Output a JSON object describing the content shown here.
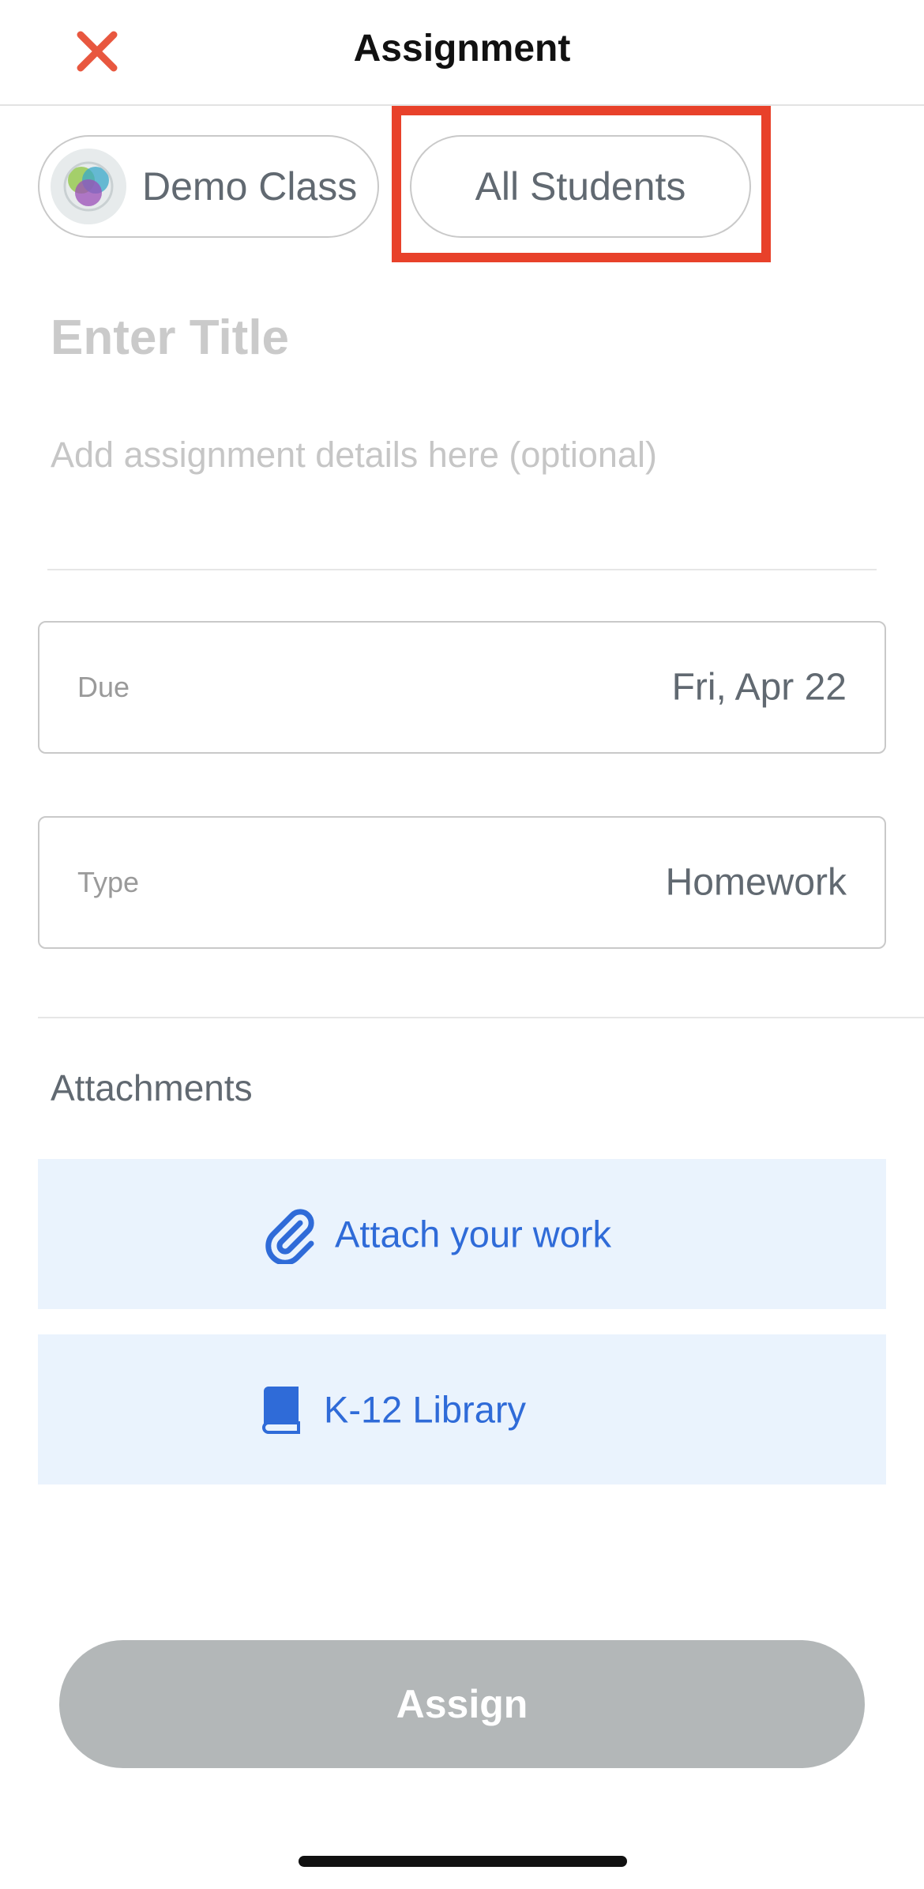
{
  "header": {
    "title": "Assignment",
    "close_icon": "close-icon",
    "accent_color": "#e8573f"
  },
  "recipients": {
    "class_label": "Demo Class",
    "class_icon": "class-avatar-icon",
    "students_label": "All Students",
    "highlight_color": "#e8412a"
  },
  "form": {
    "title_placeholder": "Enter Title",
    "details_placeholder": "Add assignment details here (optional)",
    "due": {
      "label": "Due",
      "value": "Fri, Apr 22"
    },
    "type": {
      "label": "Type",
      "value": "Homework"
    }
  },
  "attachments": {
    "heading": "Attachments",
    "attach_work": {
      "label": "Attach your work",
      "icon": "paperclip-icon"
    },
    "library": {
      "label": "K-12 Library",
      "icon": "book-icon"
    },
    "button_bg": "#eaf3fd",
    "link_color": "#2f6bd8"
  },
  "footer": {
    "assign_label": "Assign",
    "assign_bg": "#b3b7b8"
  }
}
